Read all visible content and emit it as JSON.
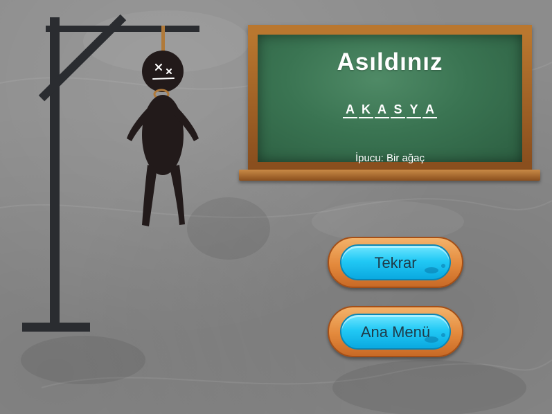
{
  "board": {
    "title": "Asıldınız",
    "word_letters": [
      "A",
      "K",
      "A",
      "S",
      "Y",
      "A"
    ],
    "hint": "İpucu: Bir ağaç"
  },
  "buttons": {
    "retry_label": "Tekrar",
    "main_menu_label": "Ana Menü"
  },
  "colors": {
    "board_green": "#3a7452",
    "board_frame": "#9a5a24",
    "gallows": "#2a2c30",
    "figure": "#221a1a",
    "rope": "#b07a3a",
    "button_orange": "#e3893c",
    "button_cyan": "#22c9f5"
  },
  "icons": {
    "gallows": "gallows-icon",
    "hanged_figure": "hanged-stickman-icon"
  }
}
